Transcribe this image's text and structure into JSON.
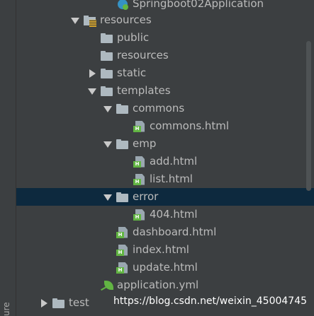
{
  "tree": {
    "rows": [
      {
        "label": "Springboot02Application",
        "icon": "spring-app-icon",
        "arrow": "none"
      },
      {
        "label": "resources",
        "icon": "resources-root-folder-icon",
        "arrow": "down"
      },
      {
        "label": "public",
        "icon": "folder-icon",
        "arrow": "none"
      },
      {
        "label": "resources",
        "icon": "folder-icon",
        "arrow": "none"
      },
      {
        "label": "static",
        "icon": "folder-icon",
        "arrow": "right"
      },
      {
        "label": "templates",
        "icon": "folder-icon",
        "arrow": "down"
      },
      {
        "label": "commons",
        "icon": "folder-icon",
        "arrow": "down"
      },
      {
        "label": "commons.html",
        "icon": "html-file-icon",
        "arrow": "none"
      },
      {
        "label": "emp",
        "icon": "folder-icon",
        "arrow": "down"
      },
      {
        "label": "add.html",
        "icon": "html-file-icon",
        "arrow": "none"
      },
      {
        "label": "list.html",
        "icon": "html-file-icon",
        "arrow": "none"
      },
      {
        "label": "error",
        "icon": "folder-icon",
        "arrow": "down"
      },
      {
        "label": "404.html",
        "icon": "html-file-icon",
        "arrow": "none"
      },
      {
        "label": "dashboard.html",
        "icon": "html-file-icon",
        "arrow": "none"
      },
      {
        "label": "index.html",
        "icon": "html-file-icon",
        "arrow": "none"
      },
      {
        "label": "update.html",
        "icon": "html-file-icon",
        "arrow": "none"
      },
      {
        "label": "application.yml",
        "icon": "yml-file-icon",
        "arrow": "none"
      },
      {
        "label": "test",
        "icon": "folder-icon",
        "arrow": "right"
      }
    ],
    "selected_label": "error"
  },
  "side_tab": {
    "label": "ure"
  },
  "watermark": {
    "text": "https://blog.csdn.net/weixin_45004745"
  },
  "colors": {
    "background": "#3c3f41",
    "selection": "#0d293e",
    "text": "#bbbbbb",
    "folder": "#aeb9c0",
    "html_badge": "#62b543"
  }
}
